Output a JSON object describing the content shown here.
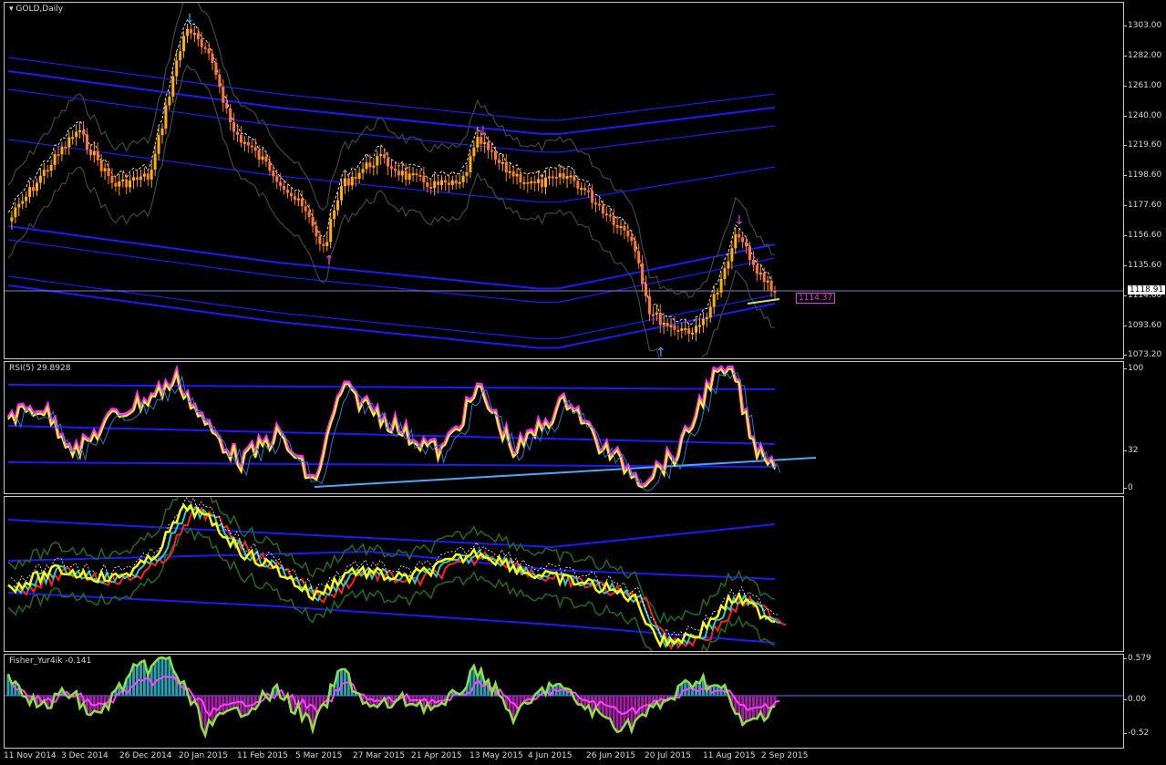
{
  "main": {
    "label": "GOLD,Daily",
    "price_ticks": [
      "1303.00",
      "1282.00",
      "1261.00",
      "1240.00",
      "1219.60",
      "1198.60",
      "1177.60",
      "1156.60",
      "1135.60",
      "1114.60",
      "1093.60",
      "1073.20"
    ],
    "current_price": "1118.91",
    "target_label": "1114.37",
    "colors": {
      "bull": "#ffb000",
      "bear": "#ff7a30",
      "envelope": "#1a1aff",
      "bands": "#3a4a4a"
    }
  },
  "rsi": {
    "label": "RSI(5) 29.8928",
    "ticks": [
      "100",
      "32",
      "0"
    ],
    "colors": {
      "line": "#ffff00",
      "highlight": "#ff30ff",
      "trend": "#4aa8ff"
    }
  },
  "ma_panel": {
    "colors": {
      "price": "#ffff00",
      "ma1": "#ff2020",
      "ma2": "#20d0d0",
      "band": "#1e6e1e"
    }
  },
  "fisher": {
    "label": "Fisher_Yur4ik -0.141",
    "ticks": [
      "0.579",
      "0.00",
      "-0.52"
    ],
    "colors": {
      "line": "#90e040",
      "signal": "#ff40ff",
      "pos": "#2a9fb0",
      "neg": "#a020a0"
    }
  },
  "x_axis": [
    "11 Nov 2014",
    "3 Dec 2014",
    "26 Dec 2014",
    "20 Jan 2015",
    "11 Feb 2015",
    "5 Mar 2015",
    "27 Mar 2015",
    "21 Apr 2015",
    "13 May 2015",
    "4 Jun 2015",
    "26 Jun 2015",
    "20 Jul 2015",
    "11 Aug 2015",
    "2 Sep 2015"
  ]
}
